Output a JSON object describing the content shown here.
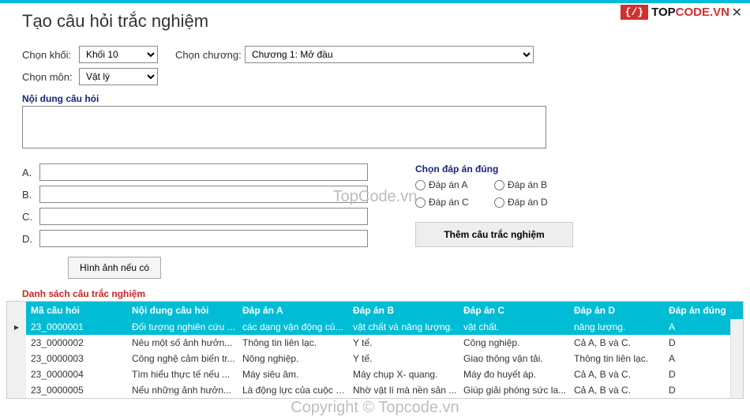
{
  "window": {
    "title": "Tạo câu hỏi trắc nghiệm",
    "close": "✕"
  },
  "logo": {
    "icon": "{/}",
    "part1": "TOP",
    "part2": "CODE.VN"
  },
  "selectors": {
    "grade_label": "Chọn khối:",
    "grade_value": "Khối 10",
    "subject_label": "Chọn môn:",
    "subject_value": "Vật lý",
    "chapter_label": "Chọn chương:",
    "chapter_value": "Chương 1: Mở đầu"
  },
  "content": {
    "group_label": "Nội dung câu hỏi",
    "value": ""
  },
  "answers": {
    "letters": [
      "A.",
      "B.",
      "C.",
      "D."
    ],
    "values": [
      "",
      "",
      "",
      ""
    ],
    "correct_label": "Chọn đáp án đúng",
    "options": [
      "Đáp án A",
      "Đáp án B",
      "Đáp án C",
      "Đáp án D"
    ]
  },
  "buttons": {
    "add": "Thêm câu trắc nghiệm",
    "image": "Hình ảnh nếu có"
  },
  "list": {
    "label": "Danh sách câu trắc nghiệm",
    "headers": [
      "Mã câu hỏi",
      "Nội dung câu hỏi",
      "Đáp án A",
      "Đáp án B",
      "Đáp án C",
      "Đáp án D",
      "Đáp án đúng"
    ],
    "rows": [
      {
        "id": "23_0000001",
        "q": "Đối tượng nghiên cứu ...",
        "a": "các dạng vận động củ...",
        "b": "vật chất và năng lượng.",
        "c": "vật chất.",
        "d": "năng lượng.",
        "ans": "A",
        "selected": true
      },
      {
        "id": "23_0000002",
        "q": "Nêu một số ảnh hưởn...",
        "a": "Thông tin liên lạc.",
        "b": "Y tế.",
        "c": "Công nghiệp.",
        "d": "Cả A, B và C.",
        "ans": "D",
        "selected": false
      },
      {
        "id": "23_0000003",
        "q": "Công nghệ cảm biến tr...",
        "a": "Nông nghiệp.",
        "b": "Y tế.",
        "c": "Giao thông vận tải.",
        "d": "Thông tin liên lạc.",
        "ans": "A",
        "selected": false
      },
      {
        "id": "23_0000004",
        "q": "Tìm hiểu thực tế nếu ...",
        "a": "Máy siêu âm.",
        "b": "Máy chụp X- quang.",
        "c": "Máy đo huyết áp.",
        "d": "Cả A, B và C.",
        "ans": "D",
        "selected": false
      },
      {
        "id": "23_0000005",
        "q": "Nếu những ảnh hưởn...",
        "a": "Là động lực của cuộc c...",
        "b": "Nhờ vật lí mà nền sản ...",
        "c": "Giúp giải phóng sức la...",
        "d": "Cả A, B và C.",
        "ans": "D",
        "selected": false
      }
    ]
  },
  "watermark": {
    "text1": "TopCode.vn",
    "text2": "Copyright © Topcode.vn"
  }
}
